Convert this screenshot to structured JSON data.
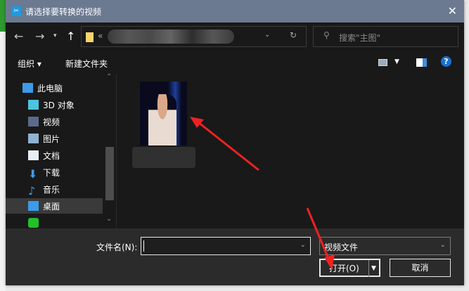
{
  "title": "请选择要转换的视频",
  "address": {
    "prefix": "«"
  },
  "search": {
    "placeholder": "搜索\"主图\""
  },
  "toolbar": {
    "organize": "组织 ▾",
    "new_folder": "新建文件夹"
  },
  "sidebar": {
    "items": [
      {
        "label": "此电脑"
      },
      {
        "label": "3D 对象"
      },
      {
        "label": "视频"
      },
      {
        "label": "图片"
      },
      {
        "label": "文档"
      },
      {
        "label": "下载"
      },
      {
        "label": "音乐"
      },
      {
        "label": "桌面"
      },
      {
        "label": ""
      }
    ]
  },
  "bottom": {
    "filename_label": "文件名(N):",
    "filename_value": "",
    "filter": "视频文件",
    "open": "打开(O)",
    "cancel": "取消"
  }
}
